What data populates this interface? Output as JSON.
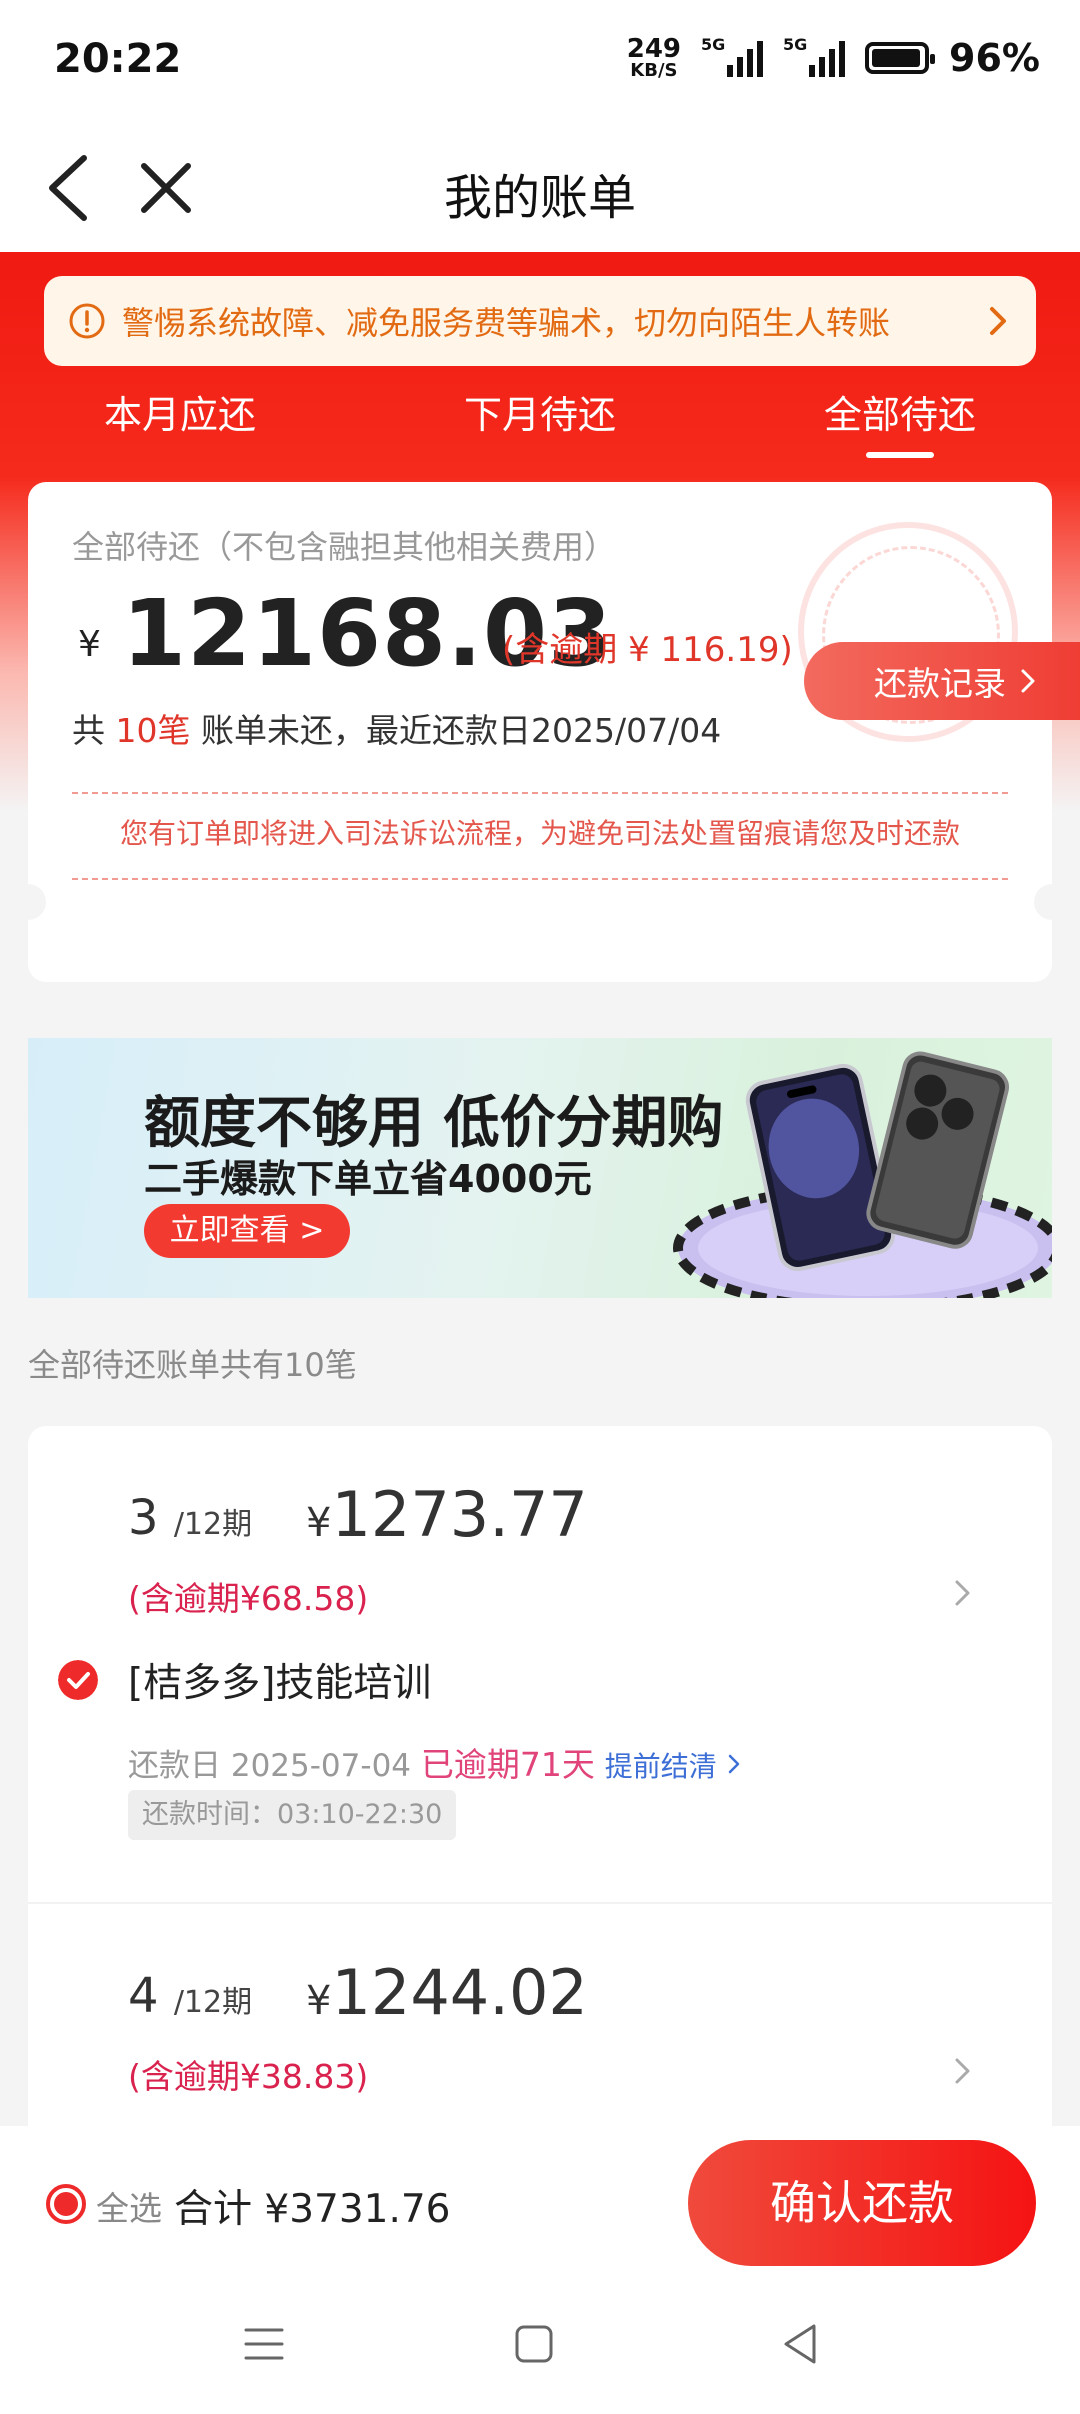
{
  "status_bar": {
    "time": "20:22",
    "net_speed_value": "249",
    "net_speed_unit": "KB/S",
    "signal_1_label": "5G",
    "signal_2_label": "5G",
    "battery": "96%"
  },
  "header": {
    "title": "我的账单"
  },
  "notice": {
    "text": "警惕系统故障、减免服务费等骗术，切勿向陌生人转账"
  },
  "tabs": [
    {
      "label": "本月应还",
      "active": false
    },
    {
      "label": "下月待还",
      "active": false
    },
    {
      "label": "全部待还",
      "active": true
    }
  ],
  "summary": {
    "label": "全部待还（不包含融担其他相关费用）",
    "currency": "¥",
    "amount": "12168.03",
    "overdue_note": "(含逾期 ¥ 116.19)",
    "line_prefix": "共",
    "bill_count": "10笔",
    "line_suffix": "账单未还，最近还款日2025/07/04",
    "legal_warning": "您有订单即将进入司法诉讼流程，为避免司法处置留痕请您及时还款",
    "repay_record_label": "还款记录"
  },
  "banner": {
    "headline": "额度不够用 低价分期购",
    "subline": "二手爆款下单立省4000元",
    "button": "立即查看 >"
  },
  "list_title": "全部待还账单共有10笔",
  "bills": [
    {
      "period_num": "3",
      "period_total": "/12期",
      "currency": "¥",
      "amount": "1273.77",
      "overdue": "(含逾期¥68.58)",
      "name": "[桔多多]技能培训",
      "due_label": "还款日 2025-07-04",
      "late_label": "已逾期71天",
      "early_label": "提前结清",
      "time_chip": "还款时间：03:10-22:30"
    },
    {
      "period_num": "4",
      "period_total": "/12期",
      "currency": "¥",
      "amount": "1244.02",
      "overdue": "(含逾期¥38.83)"
    }
  ],
  "bottom": {
    "select_all": "全选",
    "total": "合计 ¥3731.76",
    "confirm": "确认还款"
  },
  "colors": {
    "brand_red": "#f01a12",
    "notice_text": "#e26a12",
    "overdue_pink": "#d9224e",
    "link_blue": "#3d6fd6"
  }
}
